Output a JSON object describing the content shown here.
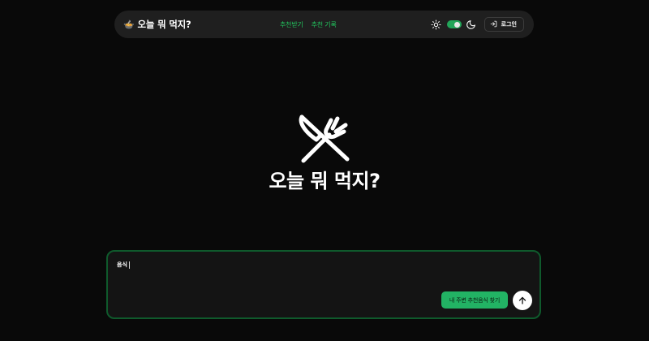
{
  "header": {
    "brand_emoji": "🍲",
    "brand_title": "오늘 뭐 먹지?",
    "nav": [
      {
        "label": "추천받기"
      },
      {
        "label": "추천 기록"
      }
    ],
    "theme_toggle": {
      "state": "on"
    },
    "login_label": "로그인"
  },
  "hero": {
    "icon": "fork-knife-icon",
    "title": "오늘 뭐 먹지?"
  },
  "prompt": {
    "value": "음식",
    "nearby_button_label": "내 주변 추천음식 찾기",
    "send_icon": "arrow-up-icon"
  },
  "colors": {
    "background": "#090909",
    "accent": "#22b364",
    "panel_border": "#0f5a2c",
    "navbar": "#1f1f1f"
  }
}
